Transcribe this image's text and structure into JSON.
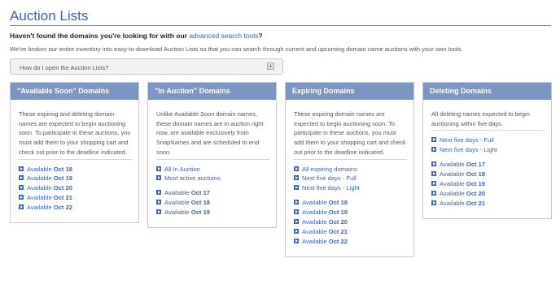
{
  "title": "Auction Lists",
  "headline": {
    "text": "Haven't found the domains you're looking for with our ",
    "link": "advanced search tools",
    "suffix": "?"
  },
  "intro": "We've broken our entire inventory into easy-to-download Auction Lists so that you can search through current and upcoming domain name auctions with your own tools.",
  "faq": {
    "label": "How do I open the Auction Lists?",
    "toggle": "+"
  },
  "panels": [
    {
      "title": "\"Available Soon\" Domains",
      "description": "These expiring and deleting domain names are expected to begin auctioning soon. To participate in these auctions, you must add them to your shopping cart and check out prior to the deadline indicated.",
      "groups": [
        [
          {
            "label": "Available ",
            "date": "Oct 18"
          },
          {
            "label": "Available ",
            "date": "Oct 19"
          },
          {
            "label": "Available ",
            "date": "Oct 20"
          },
          {
            "label": "Available ",
            "date": "Oct 21"
          },
          {
            "label": "Available ",
            "date": "Oct 22"
          }
        ]
      ]
    },
    {
      "title": "\"In Auction\" Domains",
      "description": "Unlike Available Soon domain names, these domain names are in auction right now, are available exclusively from SnapNames and are scheduled to end soon.",
      "groups": [
        [
          {
            "label": "All In Auction",
            "date": ""
          },
          {
            "label": "Most active auctions",
            "date": ""
          }
        ],
        [
          {
            "label": "Available ",
            "date": "Oct 17"
          },
          {
            "label": "Available ",
            "date": "Oct 18"
          },
          {
            "label": "Available ",
            "date": "Oct 19"
          }
        ]
      ]
    },
    {
      "title": "Expiring Domains",
      "description": "These expiring domain names are expected to begin auctioning soon. To participate in these auctions, you must add them to your shopping cart and check out prior to the deadline indicated.",
      "groups": [
        [
          {
            "label": "All expiring domains",
            "date": ""
          },
          {
            "label": "Next five days - Full",
            "date": ""
          },
          {
            "label": "Next five days - Light",
            "date": ""
          }
        ],
        [
          {
            "label": "Available ",
            "date": "Oct 18"
          },
          {
            "label": "Available ",
            "date": "Oct 19"
          },
          {
            "label": "Available ",
            "date": "Oct 20"
          },
          {
            "label": "Available ",
            "date": "Oct 21"
          },
          {
            "label": "Available ",
            "date": "Oct 22"
          }
        ]
      ]
    },
    {
      "title": "Deleting Domains",
      "description": "All deleting names expected to begin auctioning within five days.",
      "groups": [
        [
          {
            "label": "Next five days - Full",
            "date": ""
          },
          {
            "label": "Next five days - Light",
            "date": ""
          }
        ],
        [
          {
            "label": "Available ",
            "date": "Oct 17"
          },
          {
            "label": "Available ",
            "date": "Oct 18"
          },
          {
            "label": "Available ",
            "date": "Oct 19"
          },
          {
            "label": "Available ",
            "date": "Oct 20"
          },
          {
            "label": "Available ",
            "date": "Oct 21"
          }
        ]
      ]
    }
  ],
  "colors": {
    "accent": "#3b63a8",
    "panel_header": "#7b96c5"
  },
  "icons": {
    "link_bullet": "arrow-right-icon"
  }
}
